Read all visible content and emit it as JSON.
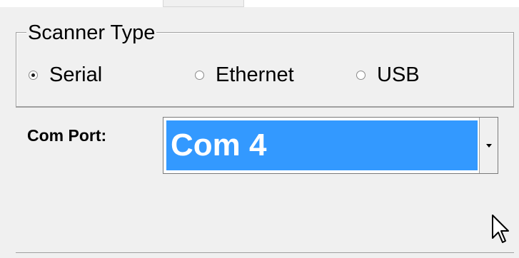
{
  "scanner_group": {
    "title": "Scanner Type",
    "options": [
      {
        "label": "Serial",
        "checked": true
      },
      {
        "label": "Ethernet",
        "checked": false
      },
      {
        "label": "USB",
        "checked": false
      }
    ]
  },
  "com_port": {
    "label": "Com Port:",
    "selected": "Com 4"
  },
  "colors": {
    "selection": "#3399ff",
    "background": "#f0f0f0"
  }
}
